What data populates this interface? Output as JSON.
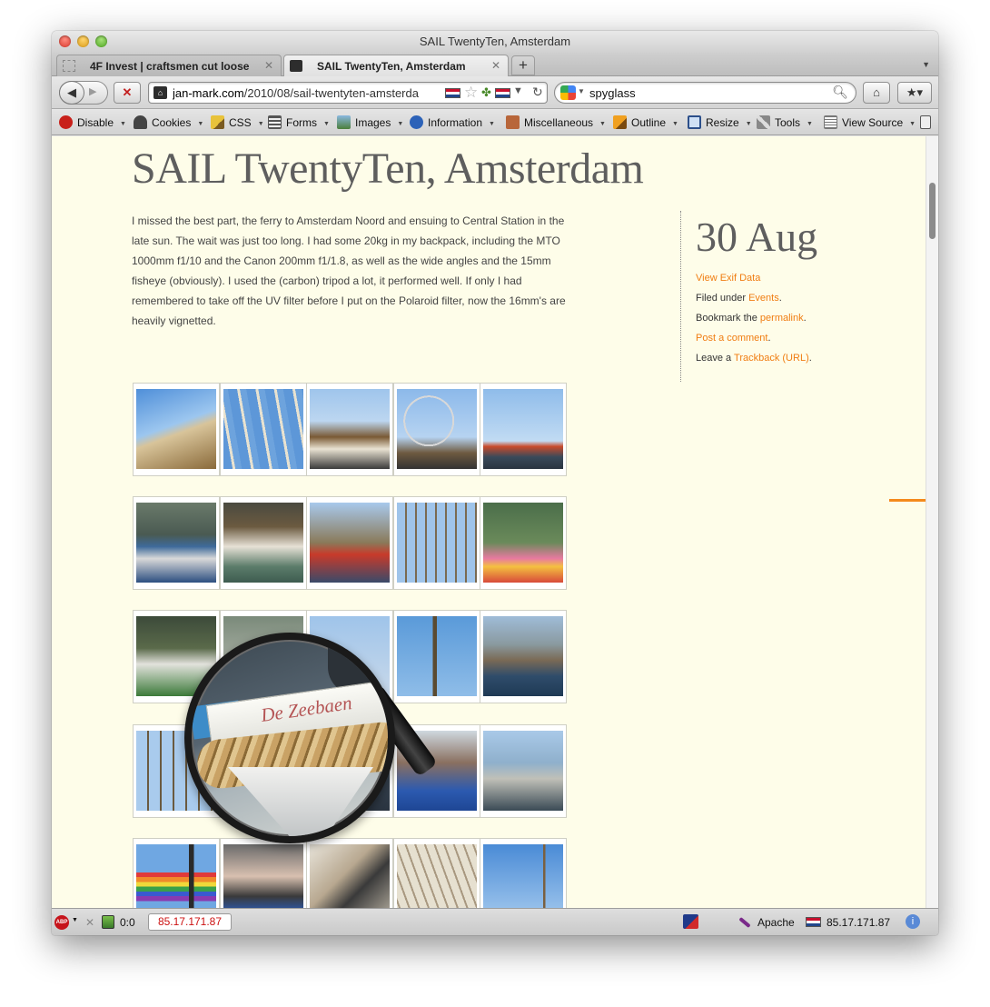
{
  "window": {
    "title": "SAIL TwentyTen, Amsterdam"
  },
  "tabs": [
    {
      "label": "4F Invest | craftsmen cut loose",
      "active": false
    },
    {
      "label": "SAIL TwentyTen, Amsterdam",
      "active": true
    }
  ],
  "navbar": {
    "url_domain": "jan-mark.com",
    "url_path": "/2010/08/sail-twentyten-amsterda",
    "search_value": "spyglass"
  },
  "devbar": {
    "items": [
      "Disable",
      "Cookies",
      "CSS",
      "Forms",
      "Images",
      "Information",
      "Miscellaneous",
      "Outline",
      "Resize",
      "Tools",
      "View Source"
    ]
  },
  "post": {
    "title": "SAIL TwentyTen, Amsterdam",
    "body": "I missed the best part, the ferry to Amsterdam Noord and ensuing to Central Station in the late sun. The wait was just too long. I had some 20kg in my backpack, including the MTO 1000mm f1/10 and the Canon 200mm f1/1.8, as well as the wide angles and the 15mm fisheye (obviously). I used the (carbon) tripod a lot, it performed well. If only I had remembered to take off the UV filter before I put on the Polaroid filter, now the 16mm's are heavily vignetted."
  },
  "sidebar": {
    "date": "30 Aug",
    "exif_link": "View Exif Data",
    "filed_prefix": "Filed under ",
    "filed_link": "Events",
    "filed_suffix": ".",
    "bookmark_prefix": "Bookmark the ",
    "bookmark_link": "permalink",
    "bookmark_suffix": ".",
    "comment_link": "Post a comment",
    "comment_suffix": ".",
    "leave_prefix": "Leave a ",
    "trackback_link": "Trackback (URL)",
    "trackback_suffix": "."
  },
  "magnifier": {
    "visible_text": "De Zeebaen"
  },
  "statusbar": {
    "counter": "0:0",
    "ip_box": "85.17.171.87",
    "server": "Apache",
    "ip_right": "85.17.171.87"
  },
  "colors": {
    "accent": "#f07d12",
    "page_bg": "#fefde9",
    "title": "#5e5e5e"
  }
}
